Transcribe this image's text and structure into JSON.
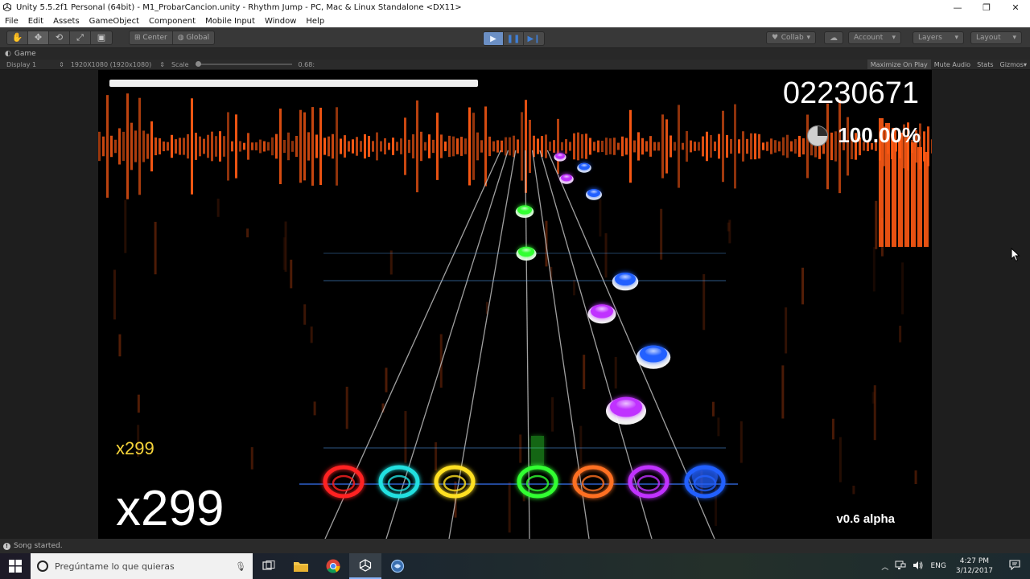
{
  "window": {
    "title": "Unity 5.5.2f1 Personal (64bit) - M1_ProbarCancion.unity - Rhythm Jump - PC, Mac & Linux Standalone <DX11>",
    "minimize": "—",
    "maximize": "❐",
    "close": "✕"
  },
  "menu": [
    "File",
    "Edit",
    "Assets",
    "GameObject",
    "Component",
    "Mobile Input",
    "Window",
    "Help"
  ],
  "toolbar": {
    "tools": [
      "hand-icon",
      "move-icon",
      "rotate-icon",
      "scale-icon",
      "rect-icon"
    ],
    "pivot": "Center",
    "space": "Global",
    "collab": "Collab",
    "account": "Account",
    "layers": "Layers",
    "layout": "Layout"
  },
  "game_panel": {
    "tab": "Game",
    "display": "Display 1",
    "resolution": "1920X1080 (1920x1080)",
    "scale_label": "Scale",
    "scale_value": "0.68:",
    "scale_fraction": 0.0,
    "maximize_on_play": "Maximize On Play",
    "mute_audio": "Mute Audio",
    "stats": "Stats",
    "gizmos": "Gizmos"
  },
  "game": {
    "score": "02230671",
    "accuracy": "100.00%",
    "combo_small": "x299",
    "combo_big": "x299",
    "version": "v0.6 alpha",
    "song_progress": 0.44,
    "colors": {
      "red": "#ff2020",
      "cyan": "#20e0e0",
      "yellow": "#ffe020",
      "green": "#30ff30",
      "orange": "#ff7020",
      "purple": "#c030ff",
      "blue": "#2060ff",
      "bars": "#ff5a14"
    }
  },
  "status": {
    "message": "Song started."
  },
  "taskbar": {
    "search_placeholder": "Pregúntame lo que quieras",
    "language": "ENG",
    "time": "4:27 PM",
    "date": "3/12/2017"
  }
}
